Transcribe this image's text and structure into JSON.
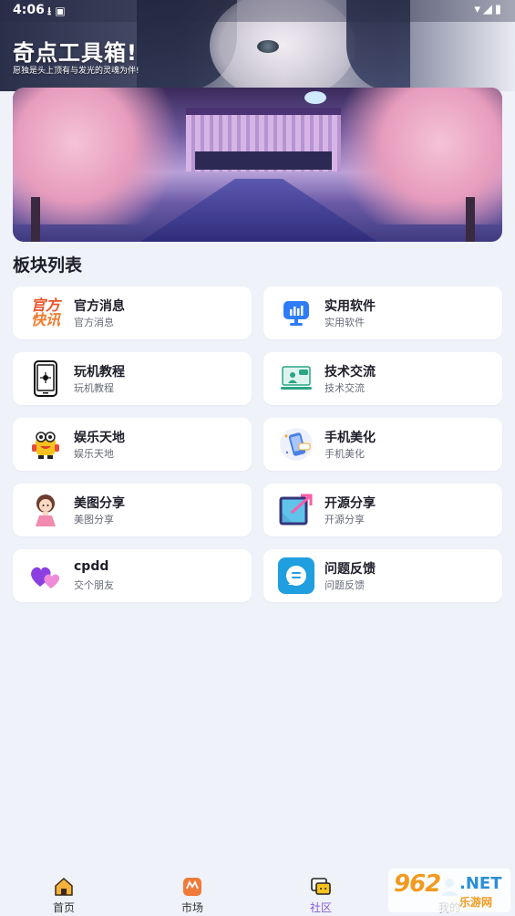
{
  "status_bar": {
    "time": "4:06",
    "left_icons": "⭳ ▣",
    "right_icons": "▾◢▮"
  },
  "header": {
    "title": "奇点工具箱!",
    "subtitle": "愿独是头上顶有与发光的灵魂为伴!"
  },
  "section_title": "板块列表",
  "cards": [
    {
      "title": "官方消息",
      "subtitle": "官方消息",
      "icon": "official-news-icon"
    },
    {
      "title": "实用软件",
      "subtitle": "实用软件",
      "icon": "software-icon"
    },
    {
      "title": "玩机教程",
      "subtitle": "玩机教程",
      "icon": "phone-icon"
    },
    {
      "title": "技术交流",
      "subtitle": "技术交流",
      "icon": "tech-chat-icon"
    },
    {
      "title": "娱乐天地",
      "subtitle": "娱乐天地",
      "icon": "entertainment-icon"
    },
    {
      "title": "手机美化",
      "subtitle": "手机美化",
      "icon": "phone-beautify-icon"
    },
    {
      "title": "美图分享",
      "subtitle": "美图分享",
      "icon": "picture-share-icon"
    },
    {
      "title": "开源分享",
      "subtitle": "开源分享",
      "icon": "open-source-icon"
    },
    {
      "title": "cpdd",
      "subtitle": "交个朋友",
      "icon": "hearts-icon"
    },
    {
      "title": "问题反馈",
      "subtitle": "问题反馈",
      "icon": "feedback-icon"
    }
  ],
  "official_icon_text": {
    "line1": "官方",
    "line2": "快讯"
  },
  "bottom_nav": {
    "home": "首页",
    "market": "市场",
    "community": "社区",
    "mine": "我的"
  },
  "watermark": {
    "num": "962",
    "net": ".NET",
    "sub": "乐游网"
  },
  "colors": {
    "accent": "#8a5ad2",
    "background": "#f0f2fa",
    "card": "#ffffff"
  }
}
